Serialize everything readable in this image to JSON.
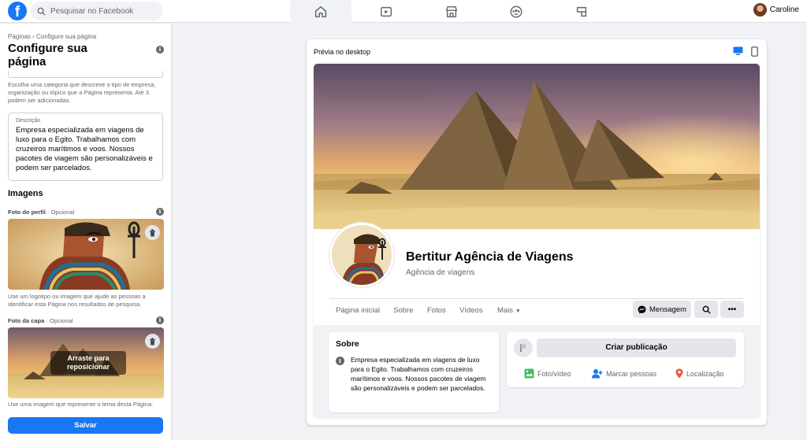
{
  "topbar": {
    "logo": "f",
    "search_placeholder": "Pesquisar no Facebook",
    "nav": [
      "home-icon",
      "watch-icon",
      "marketplace-icon",
      "groups-icon",
      "gaming-icon"
    ],
    "user_name": "Caroline"
  },
  "left": {
    "breadcrumb": "Páginas › Configure sua página",
    "title": "Configure sua página",
    "category_help": "Escolha uma categoria que descreve o tipo de empresa, organização ou tópico que a Página representa. Até 3 podem ser adicionadas.",
    "description_label": "Descrição",
    "description_text": "Empresa especializada em viagens de luxo para o Egito. Trabalhamos com cruzeiros marítimos e voos. Nossos pacotes de viagem são personalizáveis e podem ser parcelados.",
    "images_heading": "Imagens",
    "profile_photo_label": "Foto do perfil",
    "profile_photo_optional": " · Opcional",
    "profile_photo_help": "Use um logotipo ou imagem que ajude as pessoas a identificar esta Página nos resultados de pesquisa.",
    "cover_photo_label": "Foto da capa",
    "cover_photo_optional": " · Opcional",
    "drag_to_reposition": "Arraste para reposicionar",
    "cover_photo_help": "Use uma imagem que represente o tema desta Página.",
    "save_label": "Salvar"
  },
  "preview": {
    "heading": "Prévia no desktop",
    "page_name": "Bertitur Agência de Viagens",
    "page_category": "Agência de viagens",
    "tabs": [
      "Página inicial",
      "Sobre",
      "Fotos",
      "Vídeos",
      "Mais"
    ],
    "message_button": "Mensagem",
    "about_title": "Sobre",
    "about_text": "Empresa especializada em viagens de luxo para o Egito. Trabalhamos com cruzeiros marítimos e voos. Nossos pacotes de viagem são personalizáveis e podem ser parcelados.",
    "create_post": "Criar publicação",
    "actions": [
      "Foto/vídeo",
      "Marcar pessoas",
      "Localização"
    ]
  },
  "colors": {
    "brand": "#1877f2",
    "background": "#f0f2f5",
    "photo_video_green": "#45bd62",
    "tag_blue": "#1877f2",
    "location_red": "#f5533d"
  }
}
